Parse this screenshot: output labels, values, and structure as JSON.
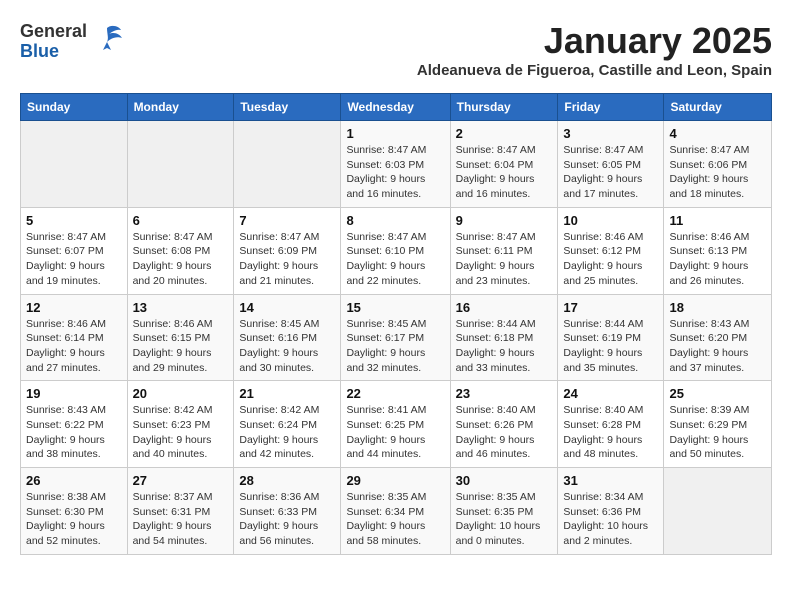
{
  "header": {
    "logo_general": "General",
    "logo_blue": "Blue",
    "month_title": "January 2025",
    "subtitle": "Aldeanueva de Figueroa, Castille and Leon, Spain"
  },
  "days_of_week": [
    "Sunday",
    "Monday",
    "Tuesday",
    "Wednesday",
    "Thursday",
    "Friday",
    "Saturday"
  ],
  "weeks": [
    [
      {
        "day": "",
        "info": ""
      },
      {
        "day": "",
        "info": ""
      },
      {
        "day": "",
        "info": ""
      },
      {
        "day": "1",
        "info": "Sunrise: 8:47 AM\nSunset: 6:03 PM\nDaylight: 9 hours and 16 minutes."
      },
      {
        "day": "2",
        "info": "Sunrise: 8:47 AM\nSunset: 6:04 PM\nDaylight: 9 hours and 16 minutes."
      },
      {
        "day": "3",
        "info": "Sunrise: 8:47 AM\nSunset: 6:05 PM\nDaylight: 9 hours and 17 minutes."
      },
      {
        "day": "4",
        "info": "Sunrise: 8:47 AM\nSunset: 6:06 PM\nDaylight: 9 hours and 18 minutes."
      }
    ],
    [
      {
        "day": "5",
        "info": "Sunrise: 8:47 AM\nSunset: 6:07 PM\nDaylight: 9 hours and 19 minutes."
      },
      {
        "day": "6",
        "info": "Sunrise: 8:47 AM\nSunset: 6:08 PM\nDaylight: 9 hours and 20 minutes."
      },
      {
        "day": "7",
        "info": "Sunrise: 8:47 AM\nSunset: 6:09 PM\nDaylight: 9 hours and 21 minutes."
      },
      {
        "day": "8",
        "info": "Sunrise: 8:47 AM\nSunset: 6:10 PM\nDaylight: 9 hours and 22 minutes."
      },
      {
        "day": "9",
        "info": "Sunrise: 8:47 AM\nSunset: 6:11 PM\nDaylight: 9 hours and 23 minutes."
      },
      {
        "day": "10",
        "info": "Sunrise: 8:46 AM\nSunset: 6:12 PM\nDaylight: 9 hours and 25 minutes."
      },
      {
        "day": "11",
        "info": "Sunrise: 8:46 AM\nSunset: 6:13 PM\nDaylight: 9 hours and 26 minutes."
      }
    ],
    [
      {
        "day": "12",
        "info": "Sunrise: 8:46 AM\nSunset: 6:14 PM\nDaylight: 9 hours and 27 minutes."
      },
      {
        "day": "13",
        "info": "Sunrise: 8:46 AM\nSunset: 6:15 PM\nDaylight: 9 hours and 29 minutes."
      },
      {
        "day": "14",
        "info": "Sunrise: 8:45 AM\nSunset: 6:16 PM\nDaylight: 9 hours and 30 minutes."
      },
      {
        "day": "15",
        "info": "Sunrise: 8:45 AM\nSunset: 6:17 PM\nDaylight: 9 hours and 32 minutes."
      },
      {
        "day": "16",
        "info": "Sunrise: 8:44 AM\nSunset: 6:18 PM\nDaylight: 9 hours and 33 minutes."
      },
      {
        "day": "17",
        "info": "Sunrise: 8:44 AM\nSunset: 6:19 PM\nDaylight: 9 hours and 35 minutes."
      },
      {
        "day": "18",
        "info": "Sunrise: 8:43 AM\nSunset: 6:20 PM\nDaylight: 9 hours and 37 minutes."
      }
    ],
    [
      {
        "day": "19",
        "info": "Sunrise: 8:43 AM\nSunset: 6:22 PM\nDaylight: 9 hours and 38 minutes."
      },
      {
        "day": "20",
        "info": "Sunrise: 8:42 AM\nSunset: 6:23 PM\nDaylight: 9 hours and 40 minutes."
      },
      {
        "day": "21",
        "info": "Sunrise: 8:42 AM\nSunset: 6:24 PM\nDaylight: 9 hours and 42 minutes."
      },
      {
        "day": "22",
        "info": "Sunrise: 8:41 AM\nSunset: 6:25 PM\nDaylight: 9 hours and 44 minutes."
      },
      {
        "day": "23",
        "info": "Sunrise: 8:40 AM\nSunset: 6:26 PM\nDaylight: 9 hours and 46 minutes."
      },
      {
        "day": "24",
        "info": "Sunrise: 8:40 AM\nSunset: 6:28 PM\nDaylight: 9 hours and 48 minutes."
      },
      {
        "day": "25",
        "info": "Sunrise: 8:39 AM\nSunset: 6:29 PM\nDaylight: 9 hours and 50 minutes."
      }
    ],
    [
      {
        "day": "26",
        "info": "Sunrise: 8:38 AM\nSunset: 6:30 PM\nDaylight: 9 hours and 52 minutes."
      },
      {
        "day": "27",
        "info": "Sunrise: 8:37 AM\nSunset: 6:31 PM\nDaylight: 9 hours and 54 minutes."
      },
      {
        "day": "28",
        "info": "Sunrise: 8:36 AM\nSunset: 6:33 PM\nDaylight: 9 hours and 56 minutes."
      },
      {
        "day": "29",
        "info": "Sunrise: 8:35 AM\nSunset: 6:34 PM\nDaylight: 9 hours and 58 minutes."
      },
      {
        "day": "30",
        "info": "Sunrise: 8:35 AM\nSunset: 6:35 PM\nDaylight: 10 hours and 0 minutes."
      },
      {
        "day": "31",
        "info": "Sunrise: 8:34 AM\nSunset: 6:36 PM\nDaylight: 10 hours and 2 minutes."
      },
      {
        "day": "",
        "info": ""
      }
    ]
  ]
}
